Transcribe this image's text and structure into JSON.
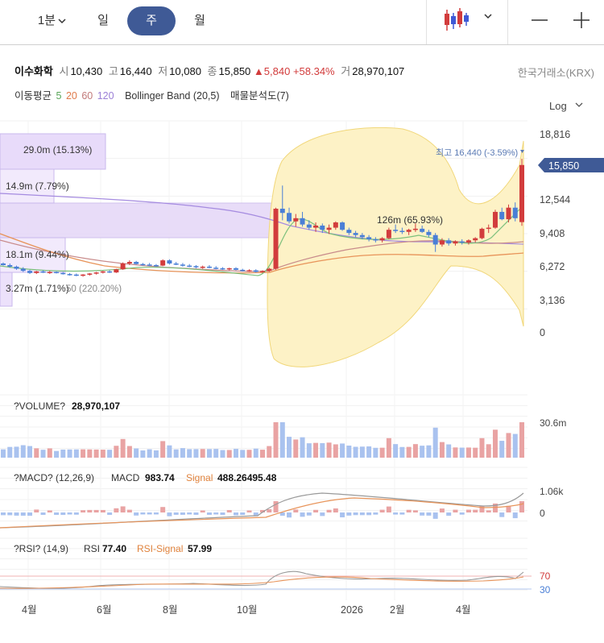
{
  "toolbar": {
    "period": "1분",
    "day": "일",
    "week": "주",
    "month": "월"
  },
  "info": {
    "name": "이수화학",
    "open_label": "시",
    "open": "10,430",
    "high_label": "고",
    "high": "16,440",
    "low_label": "저",
    "low": "10,080",
    "close_label": "종",
    "close": "15,850",
    "change": "▲5,840",
    "change_pct": "+58.34%",
    "vol_label": "거",
    "volume": "28,970,107",
    "exchange": "한국거래소(KRX)"
  },
  "indicators": {
    "ma_label": "이동평균",
    "ma5": "5",
    "ma20": "20",
    "ma60": "60",
    "ma120": "120",
    "bb": "Bollinger Band (20,5)",
    "vp": "매물분석도(7)",
    "log": "Log"
  },
  "colors": {
    "accent": "#3f5a96",
    "up": "#d23c3c",
    "down": "#4a7fd6",
    "ma5": "#5aa65a",
    "ma20": "#e07a4a",
    "ma60": "#c27a7a",
    "ma120": "#9b7fd6",
    "bb": "#fbe9a6"
  },
  "panels": {
    "volume_label": "?VOLUME?",
    "volume_value": "28,970,107",
    "macd_label": "?MACD? (12,26,9)",
    "macd_name": "MACD",
    "macd_value": "983.74",
    "signal_name": "Signal",
    "signal_value": "488.26495.48",
    "rsi_label": "?RSI? (14,9)",
    "rsi_name": "RSI",
    "rsi_value": "77.40",
    "rsi_signal_name": "RSI-Signal",
    "rsi_signal_value": "57.99"
  },
  "chart_data": {
    "type": "candlestick",
    "y_ticks": [
      "18,816",
      "12,544",
      "9,408",
      "6,272",
      "3,136",
      "0"
    ],
    "x_ticks": [
      "4월",
      "6월",
      "8월",
      "10월",
      "2026",
      "2월",
      "4월"
    ],
    "last_price": "15,850",
    "max_label": "최고 16,440 (-3.59%)",
    "volume_profile": [
      {
        "label": "29.0m (15.13%)",
        "pct": 15.13
      },
      {
        "label": "14.9m (7.79%)",
        "pct": 7.79
      },
      {
        "label": "126m (65.93%)",
        "pct": 65.93
      },
      {
        "label": "18.1m (9.44%)",
        "pct": 9.44
      },
      {
        "label": "3.27m (1.71%)",
        "pct": 1.71
      }
    ],
    "overlay_label": "50 (220.20%)",
    "volume_tick": "30.6m",
    "macd_ticks": [
      "1.06k",
      "0"
    ],
    "rsi_levels": [
      70,
      30
    ],
    "candles": [
      [
        6500,
        6600,
        6300,
        6350
      ],
      [
        6350,
        6500,
        6100,
        6200
      ],
      [
        6200,
        6300,
        5900,
        6000
      ],
      [
        6000,
        6150,
        5700,
        5800
      ],
      [
        5800,
        5900,
        5500,
        5600
      ],
      [
        5600,
        5800,
        5500,
        5750
      ],
      [
        5750,
        5850,
        5600,
        5650
      ],
      [
        5650,
        5800,
        5500,
        5700
      ],
      [
        5700,
        5750,
        5550,
        5600
      ],
      [
        5600,
        5700,
        5450,
        5500
      ],
      [
        5500,
        5600,
        5350,
        5450
      ],
      [
        5450,
        5550,
        5300,
        5380
      ],
      [
        5380,
        5500,
        5250,
        5450
      ],
      [
        5450,
        5600,
        5350,
        5550
      ],
      [
        5550,
        5700,
        5450,
        5650
      ],
      [
        5650,
        5800,
        5550,
        5750
      ],
      [
        5750,
        5850,
        5600,
        5650
      ],
      [
        5650,
        6000,
        5600,
        5950
      ],
      [
        5950,
        6600,
        5900,
        6500
      ],
      [
        6500,
        6800,
        6350,
        6650
      ],
      [
        6650,
        6750,
        6400,
        6450
      ],
      [
        6450,
        6550,
        6300,
        6400
      ],
      [
        6400,
        6550,
        6250,
        6350
      ],
      [
        6350,
        6450,
        6200,
        6300
      ],
      [
        6300,
        6900,
        6250,
        6800
      ],
      [
        6800,
        6900,
        6400,
        6500
      ],
      [
        6500,
        6650,
        6350,
        6400
      ],
      [
        6400,
        6550,
        6200,
        6300
      ],
      [
        6300,
        6450,
        6150,
        6250
      ],
      [
        6250,
        6350,
        6050,
        6150
      ],
      [
        6150,
        6300,
        6000,
        6200
      ],
      [
        6200,
        6350,
        6050,
        6100
      ],
      [
        6100,
        6250,
        5950,
        6050
      ],
      [
        6050,
        6150,
        5900,
        5950
      ],
      [
        5950,
        6100,
        5850,
        6050
      ],
      [
        6050,
        6150,
        5850,
        5900
      ],
      [
        5900,
        6000,
        5750,
        5800
      ],
      [
        5800,
        5950,
        5700,
        5850
      ],
      [
        5850,
        5950,
        5650,
        5700
      ],
      [
        5700,
        5850,
        5600,
        5800
      ],
      [
        5800,
        6100,
        5700,
        6000
      ],
      [
        6000,
        11800,
        5900,
        11700
      ],
      [
        11700,
        13900,
        10600,
        11300
      ],
      [
        11300,
        11800,
        10300,
        10500
      ],
      [
        10500,
        11200,
        10000,
        10800
      ],
      [
        10800,
        11400,
        10000,
        10200
      ],
      [
        10200,
        10600,
        9700,
        9900
      ],
      [
        9900,
        10400,
        9500,
        10100
      ],
      [
        10100,
        10300,
        9400,
        9700
      ],
      [
        9700,
        10200,
        9300,
        9900
      ],
      [
        9900,
        10500,
        9700,
        10400
      ],
      [
        10400,
        10500,
        9600,
        9700
      ],
      [
        9700,
        9900,
        9200,
        9400
      ],
      [
        9400,
        9600,
        9000,
        9200
      ],
      [
        9200,
        9400,
        8800,
        9000
      ],
      [
        9000,
        9200,
        8600,
        8800
      ],
      [
        8800,
        9000,
        8500,
        8700
      ],
      [
        8700,
        9000,
        8500,
        8900
      ],
      [
        8900,
        9900,
        8800,
        9700
      ],
      [
        9700,
        10200,
        9400,
        9600
      ],
      [
        9600,
        9900,
        9300,
        9500
      ],
      [
        9500,
        9800,
        9200,
        9700
      ],
      [
        9700,
        10300,
        9500,
        9800
      ],
      [
        9800,
        10100,
        9400,
        9500
      ],
      [
        9500,
        9700,
        9000,
        9200
      ],
      [
        9200,
        9400,
        7600,
        8300
      ],
      [
        8300,
        8900,
        8100,
        8700
      ],
      [
        8700,
        8900,
        8200,
        8400
      ],
      [
        8400,
        8700,
        8200,
        8600
      ],
      [
        8600,
        8800,
        8300,
        8500
      ],
      [
        8500,
        8800,
        8300,
        8700
      ],
      [
        8700,
        9000,
        8500,
        8900
      ],
      [
        8900,
        9900,
        8800,
        9800
      ],
      [
        9800,
        10200,
        9400,
        9900
      ],
      [
        9900,
        11600,
        9800,
        11400
      ],
      [
        11400,
        11800,
        10600,
        10700
      ],
      [
        10700,
        12100,
        10400,
        11800
      ],
      [
        11800,
        12300,
        10500,
        10800
      ],
      [
        10430,
        16440,
        10080,
        15850
      ]
    ]
  }
}
